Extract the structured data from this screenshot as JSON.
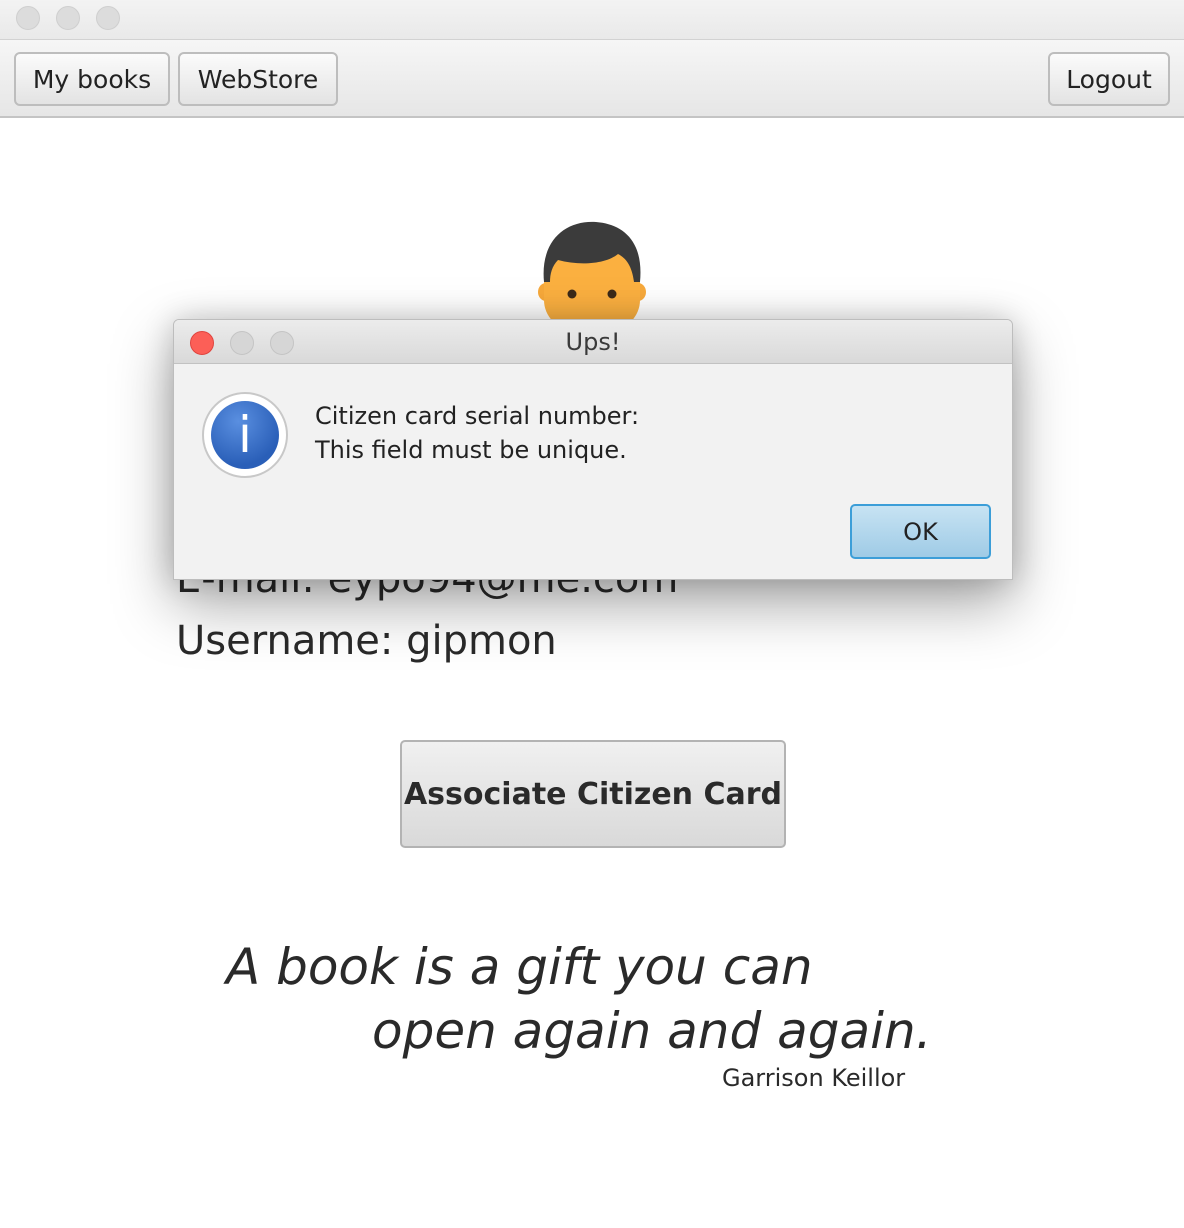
{
  "toolbar": {
    "my_books_label": "My books",
    "webstore_label": "WebStore",
    "logout_label": "Logout"
  },
  "profile": {
    "email_line": "E-mail: eypo94@me.com",
    "username_line": "Username: gipmon",
    "avatar_icon": "user-avatar-icon"
  },
  "actions": {
    "associate_label": "Associate Citizen Card"
  },
  "quote": {
    "line1": "A book is a gift you can",
    "line2": "open again and again.",
    "author": "Garrison Keillor"
  },
  "dialog": {
    "title": "Ups!",
    "icon": "info-icon",
    "message_line1": "Citizen card serial number:",
    "message_line2": "This field must be unique.",
    "ok_label": "OK"
  },
  "colors": {
    "close_dot": "#fc5f57",
    "ok_border": "#3c9ed8",
    "info_blue": "#2a5fb8"
  }
}
